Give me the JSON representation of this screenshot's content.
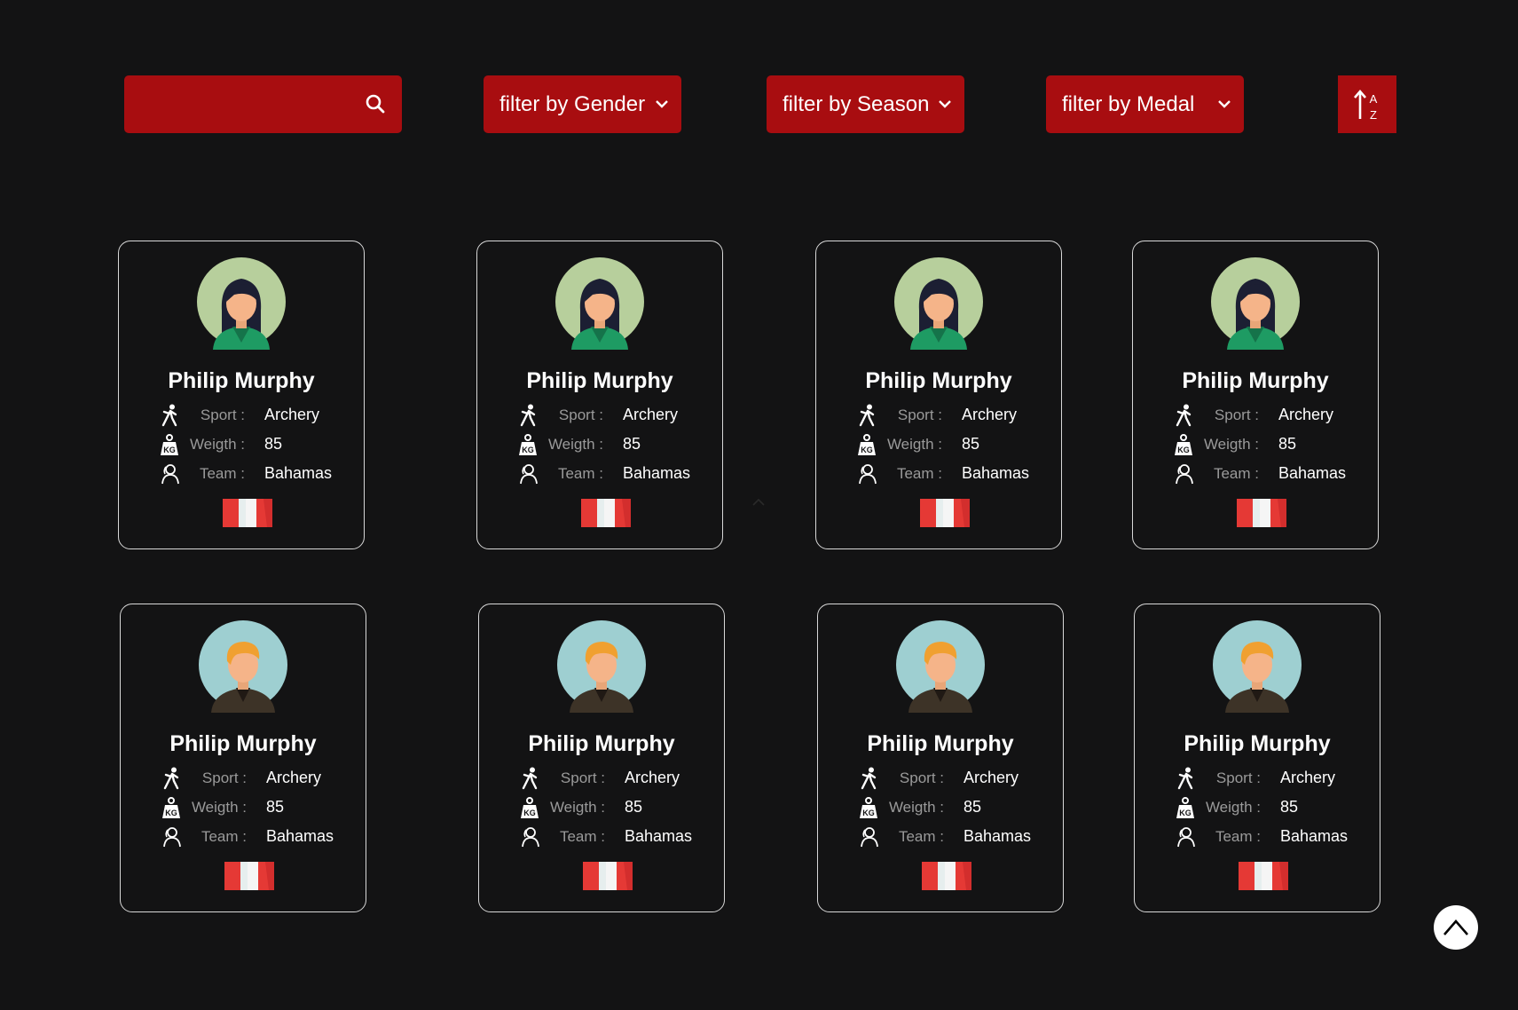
{
  "toolbar": {
    "search": {
      "placeholder": "",
      "value": ""
    },
    "filters": [
      {
        "label": "filter by Gender"
      },
      {
        "label": "filter by Season"
      },
      {
        "label": "filter by Medal"
      }
    ],
    "sort": {
      "icon": "sort-alpha-icon",
      "top_letter": "A",
      "bottom_letter": "Z"
    }
  },
  "labels": {
    "sport": "Sport :",
    "weight": "Weigth :",
    "team": "Team :"
  },
  "athletes": [
    {
      "name": "Philip Murphy",
      "sport": "Archery",
      "weight": "85",
      "team": "Bahamas",
      "avatar": "female"
    },
    {
      "name": "Philip Murphy",
      "sport": "Archery",
      "weight": "85",
      "team": "Bahamas",
      "avatar": "female"
    },
    {
      "name": "Philip Murphy",
      "sport": "Archery",
      "weight": "85",
      "team": "Bahamas",
      "avatar": "female"
    },
    {
      "name": "Philip Murphy",
      "sport": "Archery",
      "weight": "85",
      "team": "Bahamas",
      "avatar": "female"
    },
    {
      "name": "Philip Murphy",
      "sport": "Archery",
      "weight": "85",
      "team": "Bahamas",
      "avatar": "male"
    },
    {
      "name": "Philip Murphy",
      "sport": "Archery",
      "weight": "85",
      "team": "Bahamas",
      "avatar": "male"
    },
    {
      "name": "Philip Murphy",
      "sport": "Archery",
      "weight": "85",
      "team": "Bahamas",
      "avatar": "male"
    },
    {
      "name": "Philip Murphy",
      "sport": "Archery",
      "weight": "85",
      "team": "Bahamas",
      "avatar": "male"
    }
  ],
  "colors": {
    "accent": "#a80d10",
    "background": "#131314",
    "flag_red": "#e53935",
    "flag_white": "#f5f5f5"
  }
}
